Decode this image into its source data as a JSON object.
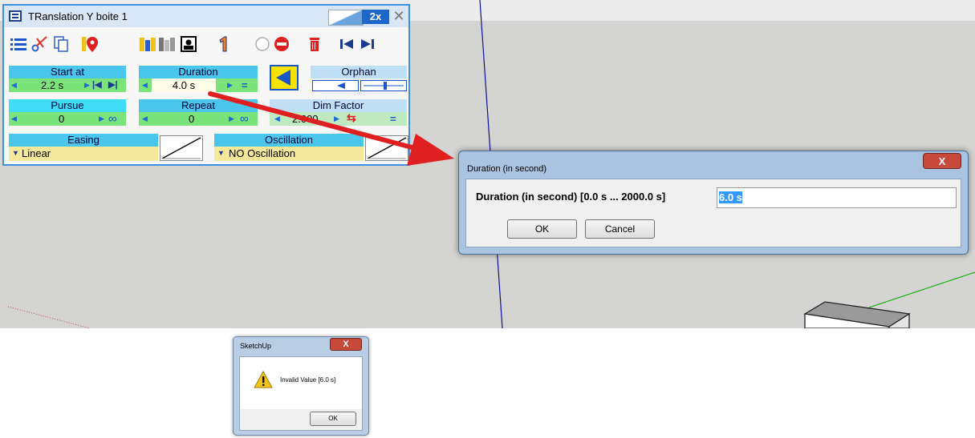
{
  "panel": {
    "title": "TRanslation Y boite 1",
    "zoom_label": "2x",
    "start_at": {
      "label": "Start at",
      "value": "2.2 s"
    },
    "duration": {
      "label": "Duration",
      "value": "4.0 s",
      "equals": "="
    },
    "orphan": {
      "label": "Orphan"
    },
    "pursue": {
      "label": "Pursue",
      "value": "0"
    },
    "repeat": {
      "label": "Repeat",
      "value": "0"
    },
    "dim_factor": {
      "label": "Dim Factor",
      "value": "2.000",
      "equals": "="
    },
    "easing": {
      "label": "Easing",
      "value": "Linear"
    },
    "oscillation": {
      "label": "Oscillation",
      "value": "NO Oscillation"
    },
    "infinity_symbol": "∞",
    "accent_color": "#3d8fe0"
  },
  "duration_dialog": {
    "title": "Duration (in second)",
    "prompt": "Duration (in second)  [0.0 s ... 2000.0 s]",
    "input_value": "6.0 s",
    "ok_label": "OK",
    "cancel_label": "Cancel",
    "close_label": "X"
  },
  "message_box": {
    "title": "SketchUp",
    "message": "Invalid Value [6.0 s]",
    "ok_label": "OK",
    "close_label": "X"
  },
  "colors": {
    "canvas_background": "#d4d4d2",
    "annotation_arrow": "#e02020",
    "blue_axis": "#1010a0",
    "green_axis": "#20b020"
  }
}
